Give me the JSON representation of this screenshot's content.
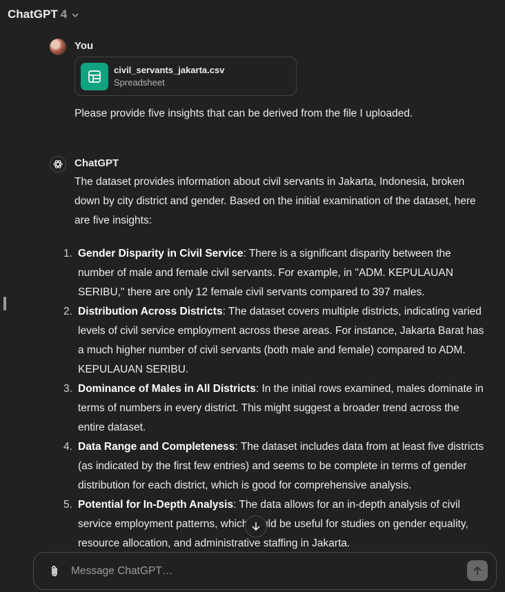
{
  "header": {
    "title": "ChatGPT",
    "version": "4"
  },
  "user_message": {
    "author": "You",
    "attachment": {
      "file_name": "civil_servants_jakarta.csv",
      "file_type": "Spreadsheet"
    },
    "text": "Please provide five insights that can be derived from the file I uploaded."
  },
  "assistant_message": {
    "author": "ChatGPT",
    "intro": "The dataset provides information about civil servants in Jakarta, Indonesia, broken down by city district and gender. Based on the initial examination of the dataset, here are five insights:",
    "insights": [
      {
        "number": "1.",
        "title": "Gender Disparity in Civil Service",
        "text": ": There is a significant disparity between the number of male and female civil servants. For example, in \"ADM. KEPULAUAN SERIBU,\" there are only 12 female civil servants compared to 397 males."
      },
      {
        "number": "2.",
        "title": "Distribution Across Districts",
        "text": ": The dataset covers multiple districts, indicating varied levels of civil service employment across these areas. For instance, Jakarta Barat has a much higher number of civil servants (both male and female) compared to ADM. KEPULAUAN SERIBU."
      },
      {
        "number": "3.",
        "title": "Dominance of Males in All Districts",
        "text": ": In the initial rows examined, males dominate in terms of numbers in every district. This might suggest a broader trend across the entire dataset."
      },
      {
        "number": "4.",
        "title": "Data Range and Completeness",
        "text": ": The dataset includes data from at least five districts (as indicated by the first few entries) and seems to be complete in terms of gender distribution for each district, which is good for comprehensive analysis."
      },
      {
        "number": "5.",
        "title": "Potential for In-Depth Analysis",
        "text": ": The data allows for an in-depth analysis of civil service employment patterns, which could be useful for studies on gender equality, resource allocation, and administrative staffing in Jakarta."
      }
    ]
  },
  "composer": {
    "placeholder": "Message ChatGPT…"
  },
  "icons": {
    "model_dropdown": "chevron-down-icon",
    "file": "spreadsheet-icon",
    "assistant_avatar": "openai-logo-icon",
    "scroll": "arrow-down-icon",
    "attach": "paperclip-icon",
    "send": "arrow-up-icon"
  },
  "colors": {
    "background": "#212121",
    "file_icon": "#10a37f",
    "send_button": "#676767"
  }
}
